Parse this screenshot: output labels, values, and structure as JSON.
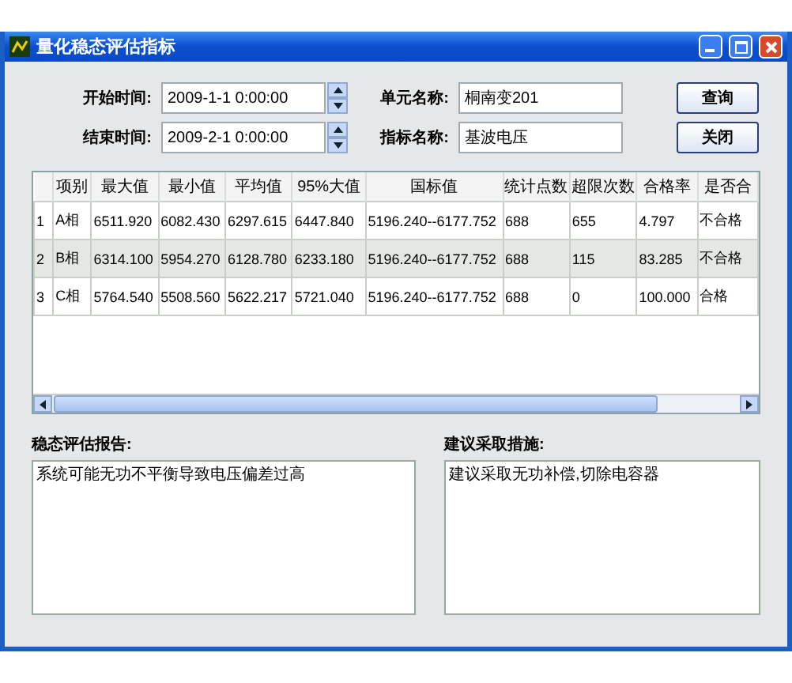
{
  "window": {
    "title": "量化稳态评估指标"
  },
  "form": {
    "start_label": "开始时间:",
    "start_value": "2009-1-1  0:00:00",
    "end_label": "结束时间:",
    "end_value": "2009-2-1  0:00:00",
    "unit_label": "单元名称:",
    "unit_value": "桐南变201",
    "index_label": "指标名称:",
    "index_value": "基波电压"
  },
  "buttons": [
    "查询",
    "关闭"
  ],
  "table": {
    "columns": [
      "",
      "项别",
      "最大值",
      "最小值",
      "平均值",
      "95%大值",
      "国标值",
      "统计点数",
      "超限次数",
      "合格率",
      "是否合"
    ],
    "rows": [
      {
        "selected": false,
        "cells": [
          "1",
          "A相",
          "6511.920",
          "6082.430",
          "6297.615",
          "6447.840",
          "5196.240--6177.752",
          "688",
          "655",
          "4.797",
          "不合格"
        ]
      },
      {
        "selected": true,
        "cells": [
          "2",
          "B相",
          "6314.100",
          "5954.270",
          "6128.780",
          "6233.180",
          "5196.240--6177.752",
          "688",
          "115",
          "83.285",
          "不合格"
        ]
      },
      {
        "selected": false,
        "cells": [
          "3",
          "C相",
          "5764.540",
          "5508.560",
          "5622.217",
          "5721.040",
          "5196.240--6177.752",
          "688",
          "0",
          "100.000",
          "合格"
        ]
      }
    ]
  },
  "report": {
    "label": "稳态评估报告:",
    "text": "系统可能无功不平衡导致电压偏差过高"
  },
  "advice": {
    "label": "建议采取措施:",
    "text": "建议采取无功补偿,切除电容器"
  }
}
